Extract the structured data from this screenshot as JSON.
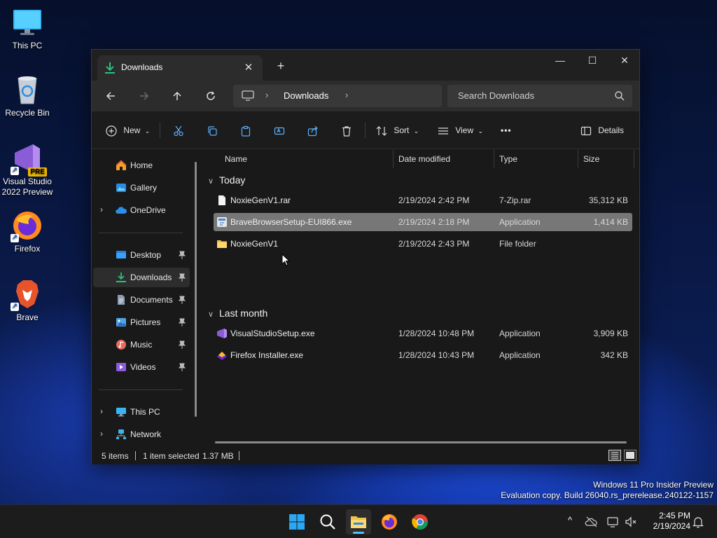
{
  "desktop": {
    "icons": [
      {
        "label": "This PC",
        "icon": "monitor-icon"
      },
      {
        "label": "Recycle Bin",
        "icon": "recycle-bin-icon"
      },
      {
        "label": "Visual Studio 2022 Preview",
        "icon": "visual-studio-icon",
        "badge": "PRE"
      },
      {
        "label": "Firefox",
        "icon": "firefox-icon"
      },
      {
        "label": "Brave",
        "icon": "brave-icon"
      }
    ]
  },
  "window": {
    "tab_title": "Downloads",
    "tab_close": "✕",
    "new_tab": "+",
    "controls": {
      "minimize": "—",
      "maximize": "☐",
      "close": "✕"
    },
    "breadcrumb": {
      "current": "Downloads",
      "sep": "›"
    },
    "search_placeholder": "Search Downloads",
    "commands": {
      "new": "New",
      "sort": "Sort",
      "view": "View",
      "more": "•••",
      "details": "Details"
    },
    "nav": {
      "quick": [
        {
          "label": "Home",
          "icon": "home-icon"
        },
        {
          "label": "Gallery",
          "icon": "gallery-icon"
        },
        {
          "label": "OneDrive",
          "icon": "onedrive-icon",
          "expandable": true
        }
      ],
      "pinned": [
        {
          "label": "Desktop",
          "icon": "desktop-folder-icon",
          "color": "#3aa0ff"
        },
        {
          "label": "Downloads",
          "icon": "download-icon",
          "color": "#29c27f",
          "selected": true
        },
        {
          "label": "Documents",
          "icon": "documents-icon",
          "color": "#8e9bb0"
        },
        {
          "label": "Pictures",
          "icon": "pictures-icon",
          "color": "#4ea3e8"
        },
        {
          "label": "Music",
          "icon": "music-icon",
          "color": "#e86a5a"
        },
        {
          "label": "Videos",
          "icon": "videos-icon",
          "color": "#8b5be0"
        }
      ],
      "devices": [
        {
          "label": "This PC",
          "icon": "this-pc-icon"
        },
        {
          "label": "Network",
          "icon": "network-icon"
        }
      ],
      "expand_glyph": "›"
    },
    "columns": {
      "name": "Name",
      "date": "Date modified",
      "type": "Type",
      "size": "Size"
    },
    "groups": [
      {
        "label": "Today",
        "files": [
          {
            "name": "NoxieGenV1.rar",
            "date": "2/19/2024 2:42 PM",
            "type": "7-Zip.rar",
            "size": "35,312 KB",
            "icon": "file-icon",
            "selected": false
          },
          {
            "name": "BraveBrowserSetup-EUI866.exe",
            "date": "2/19/2024 2:18 PM",
            "type": "Application",
            "size": "1,414 KB",
            "icon": "installer-icon",
            "selected": true
          },
          {
            "name": "NoxieGenV1",
            "date": "2/19/2024 2:43 PM",
            "type": "File folder",
            "size": "",
            "icon": "folder-icon",
            "selected": false
          }
        ]
      },
      {
        "label": "Last month",
        "files": [
          {
            "name": "VisualStudioSetup.exe",
            "date": "1/28/2024 10:48 PM",
            "type": "Application",
            "size": "3,909 KB",
            "icon": "visual-studio-setup-icon",
            "selected": false
          },
          {
            "name": "Firefox Installer.exe",
            "date": "1/28/2024 10:43 PM",
            "type": "Application",
            "size": "342 KB",
            "icon": "firefox-installer-icon",
            "selected": false
          }
        ]
      }
    ],
    "status": {
      "items": "5 items",
      "selected": "1 item selected",
      "size": "1.37 MB"
    }
  },
  "watermark": {
    "line1": "Windows 11 Pro Insider Preview",
    "line2": "Evaluation copy. Build 26040.rs_prerelease.240122-1157"
  },
  "taskbar": {
    "apps": [
      {
        "name": "start",
        "icon": "windows-start-icon"
      },
      {
        "name": "search",
        "icon": "search-icon"
      },
      {
        "name": "file-explorer",
        "icon": "file-explorer-icon",
        "active": true
      },
      {
        "name": "firefox",
        "icon": "firefox-icon"
      },
      {
        "name": "chrome",
        "icon": "chrome-icon"
      }
    ],
    "tray": {
      "chevron": "^"
    },
    "clock": {
      "time": "2:45 PM",
      "date": "2/19/2024"
    }
  }
}
